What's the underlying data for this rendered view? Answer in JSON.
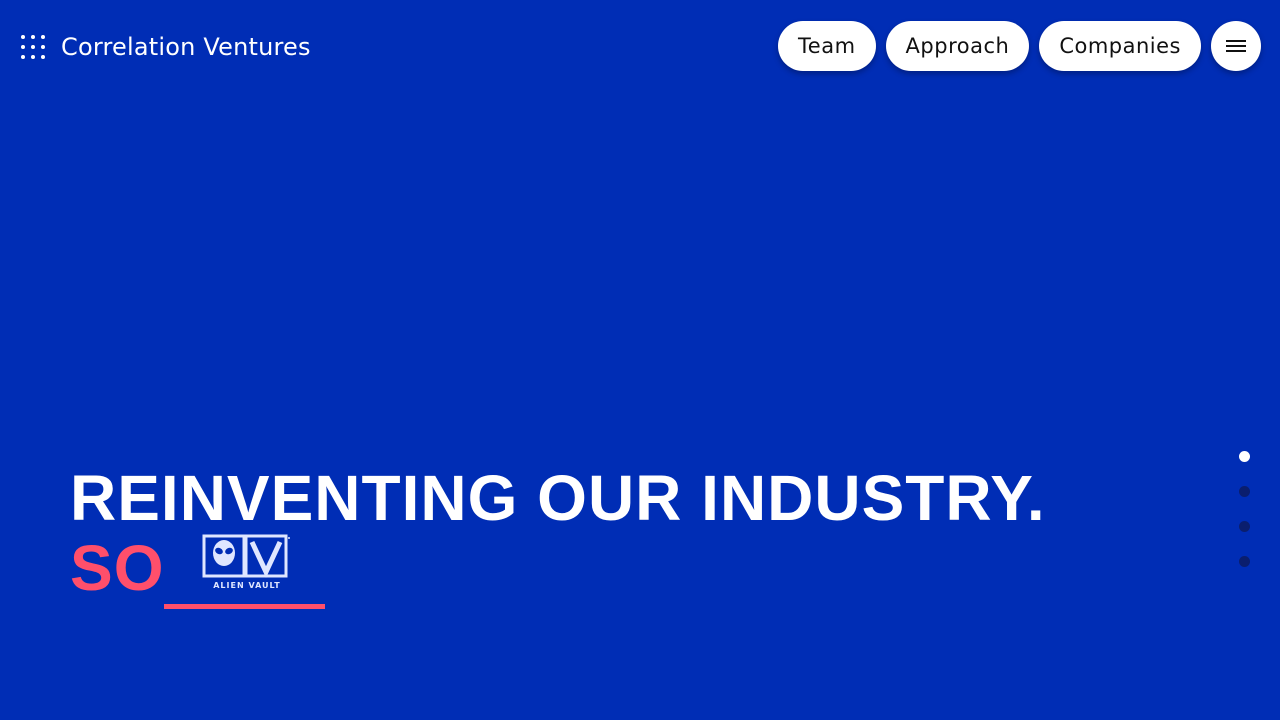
{
  "header": {
    "brand": "Correlation Ventures",
    "logo_icon": "dot-grid-logo-icon",
    "nav": [
      {
        "label": "Team"
      },
      {
        "label": "Approach"
      },
      {
        "label": "Companies"
      }
    ],
    "menu_icon": "hamburger-menu-icon"
  },
  "hero": {
    "line1": "REINVENTING OUR INDUSTRY.",
    "line2_prefix": "SO",
    "company_logo": {
      "icon": "alien-head-icon",
      "name": "ALIEN VAULT"
    }
  },
  "slides": {
    "count": 4,
    "active_index": 0
  },
  "colors": {
    "background": "#002db5",
    "accent": "#ff4f6b",
    "text": "#ffffff",
    "dot_active": "#ffffff",
    "dot_inactive": "#0a1e6e"
  }
}
